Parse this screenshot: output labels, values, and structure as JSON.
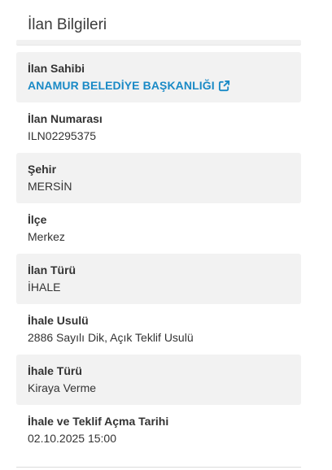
{
  "panel": {
    "title": "İlan Bilgileri"
  },
  "rows": [
    {
      "label": "İlan Sahibi",
      "value": "ANAMUR BELEDİYE BAŞKANLIĞI",
      "is_link": true,
      "icon": "external-link-icon"
    },
    {
      "label": "İlan Numarası",
      "value": "ILN02295375"
    },
    {
      "label": "Şehir",
      "value": "MERSİN"
    },
    {
      "label": "İlçe",
      "value": "Merkez"
    },
    {
      "label": "İlan Türü",
      "value": "İHALE"
    },
    {
      "label": "İhale Usulü",
      "value": "2886 Sayılı Dik, Açık Teklif Usulü"
    },
    {
      "label": "İhale Türü",
      "value": "Kiraya Verme"
    },
    {
      "label": "İhale ve Teklif Açma Tarihi",
      "value": "02.10.2025 15:00"
    }
  ],
  "colors": {
    "link": "#1a8ac6",
    "shaded_row": "#f2f2f2",
    "text": "#333333"
  }
}
